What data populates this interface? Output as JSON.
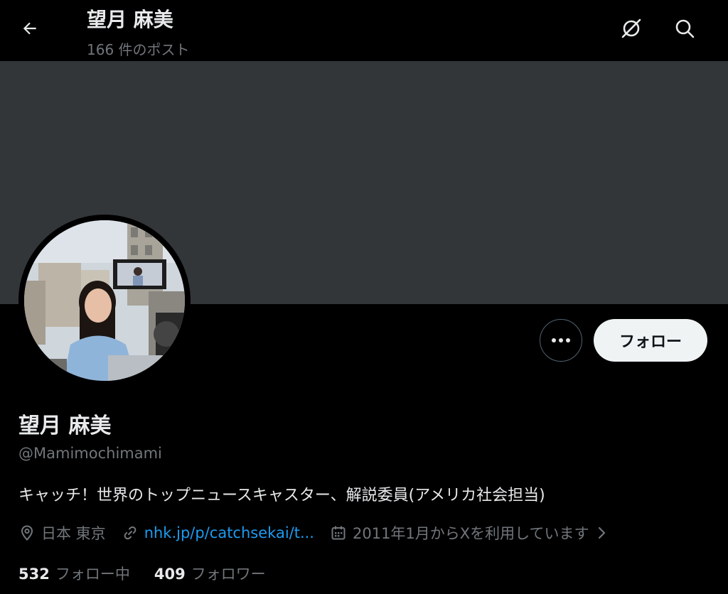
{
  "header": {
    "title": "望月 麻美",
    "post_count": "166 件のポスト"
  },
  "icons": {
    "back": "arrow-left-icon",
    "notify": "notification-off-icon",
    "search": "search-icon",
    "more": "ellipsis-icon",
    "location": "location-pin-icon",
    "link": "link-icon",
    "calendar": "calendar-icon",
    "chevron": "chevron-right-icon"
  },
  "colors": {
    "background": "#000000",
    "banner": "#333639",
    "link": "#1d9bf0",
    "muted": "#71767b",
    "follow_button_bg": "#eff3f4"
  },
  "profile": {
    "display_name": "望月 麻美",
    "handle": "@Mamimochimami",
    "bio": "キャッチ！世界のトップニュースキャスター、解説委員(アメリカ社会担当)",
    "location": "日本 東京",
    "website": "nhk.jp/p/catchsekai/t...",
    "joined": "2011年1月からXを利用しています"
  },
  "actions": {
    "follow_label": "フォロー"
  },
  "stats": {
    "following_count": "532",
    "following_label": "フォロー中",
    "followers_count": "409",
    "followers_label": "フォロワー"
  }
}
